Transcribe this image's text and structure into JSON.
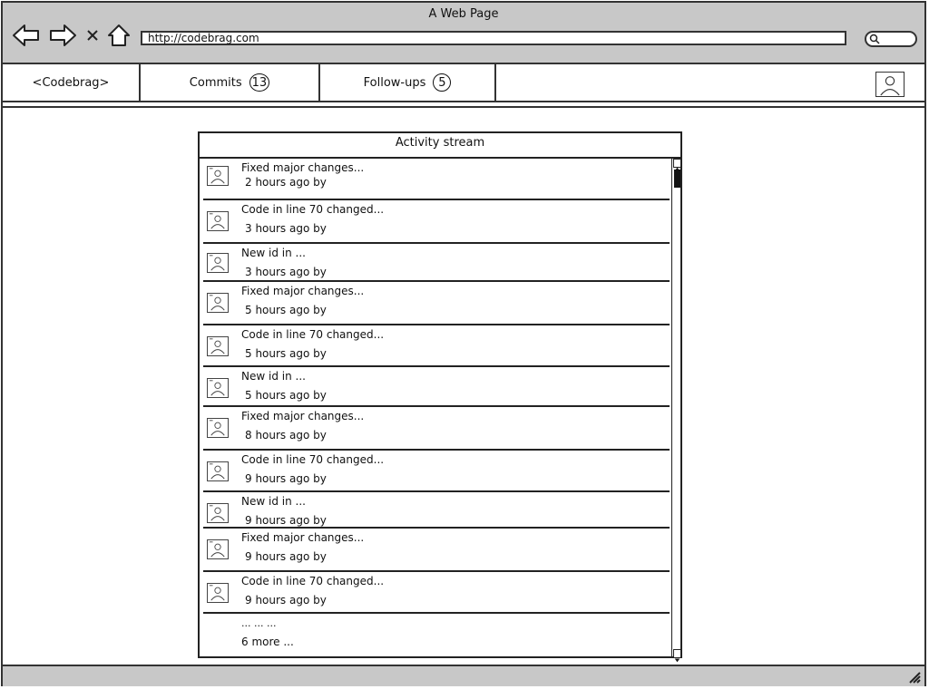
{
  "window": {
    "title": "A Web Page"
  },
  "browser": {
    "url": "http://codebrag.com",
    "icons": [
      "back-arrow-icon",
      "forward-arrow-icon",
      "close-x-icon",
      "home-icon",
      "search-icon"
    ]
  },
  "nav": {
    "brand": "<Codebrag>",
    "commits_label": "Commits",
    "commits_count": "13",
    "followups_label": "Follow-ups",
    "followups_count": "5"
  },
  "stream": {
    "title": "Activity stream",
    "items": [
      {
        "title": "Fixed major changes...",
        "meta": "2 hours ago by"
      },
      {
        "title": "Code in line 70 changed...",
        "meta": "3 hours ago by"
      },
      {
        "title": "New id in ...",
        "meta": "3 hours ago by"
      },
      {
        "title": "Fixed major changes...",
        "meta": "5 hours ago by"
      },
      {
        "title": "Code in line 70 changed...",
        "meta": "5 hours ago by"
      },
      {
        "title": "New id in ...",
        "meta": "5 hours ago by"
      },
      {
        "title": "Fixed major changes...",
        "meta": "8 hours ago by"
      },
      {
        "title": "Code in line 70 changed...",
        "meta": "9 hours ago by"
      },
      {
        "title": "New id in ...",
        "meta": "9 hours ago by"
      },
      {
        "title": "Fixed major changes...",
        "meta": "9 hours ago by"
      },
      {
        "title": "Code in line 70 changed...",
        "meta": "9 hours ago by"
      }
    ],
    "ellipsis": "... ... ...",
    "more": "6 more ..."
  }
}
